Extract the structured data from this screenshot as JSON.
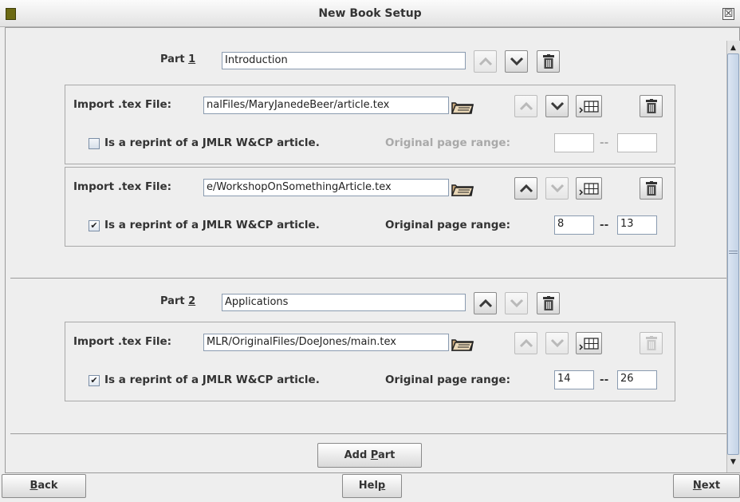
{
  "window": {
    "title": "New Book Setup",
    "close_glyph": "☒"
  },
  "icons": {
    "up": "chevron-up-icon",
    "down": "chevron-down-icon",
    "delete": "trash-icon",
    "browse": "folder-icon",
    "insert": "insert-table-icon"
  },
  "parts": [
    {
      "prefix": "Part ",
      "number": "1",
      "title": "Introduction",
      "files": [
        {
          "import_label": "Import .tex File:",
          "path": "nalFiles/MaryJanedeBeer/article.tex",
          "reprint_label": "Is a reprint of a JMLR W&CP article.",
          "reprint_checked": false,
          "range_label": "Original page range:",
          "range_sep": "--",
          "range_start": "",
          "range_end": ""
        },
        {
          "import_label": "Import .tex File:",
          "path": "e/WorkshopOnSomethingArticle.tex",
          "reprint_label": "Is a reprint of a JMLR W&CP article.",
          "reprint_checked": true,
          "range_label": "Original page range:",
          "range_sep": "--",
          "range_start": "8",
          "range_end": "13"
        }
      ]
    },
    {
      "prefix": "Part ",
      "number": "2",
      "title": "Applications",
      "files": [
        {
          "import_label": "Import .tex File:",
          "path": "MLR/OriginalFiles/DoeJones/main.tex",
          "reprint_label": "Is a reprint of a JMLR W&CP article.",
          "reprint_checked": true,
          "range_label": "Original page range:",
          "range_sep": "--",
          "range_start": "14",
          "range_end": "26"
        }
      ]
    }
  ],
  "add_part": {
    "prefix": "Add ",
    "mnemonic": "P",
    "suffix": "art"
  },
  "footer": {
    "back": {
      "mnemonic": "B",
      "rest": "ack"
    },
    "help": {
      "prefix": "Hel",
      "mnemonic": "p"
    },
    "next": {
      "mnemonic": "N",
      "rest": "ext"
    }
  },
  "scrollbar": {
    "up_arrow": "▲",
    "down_arrow": "▼"
  }
}
